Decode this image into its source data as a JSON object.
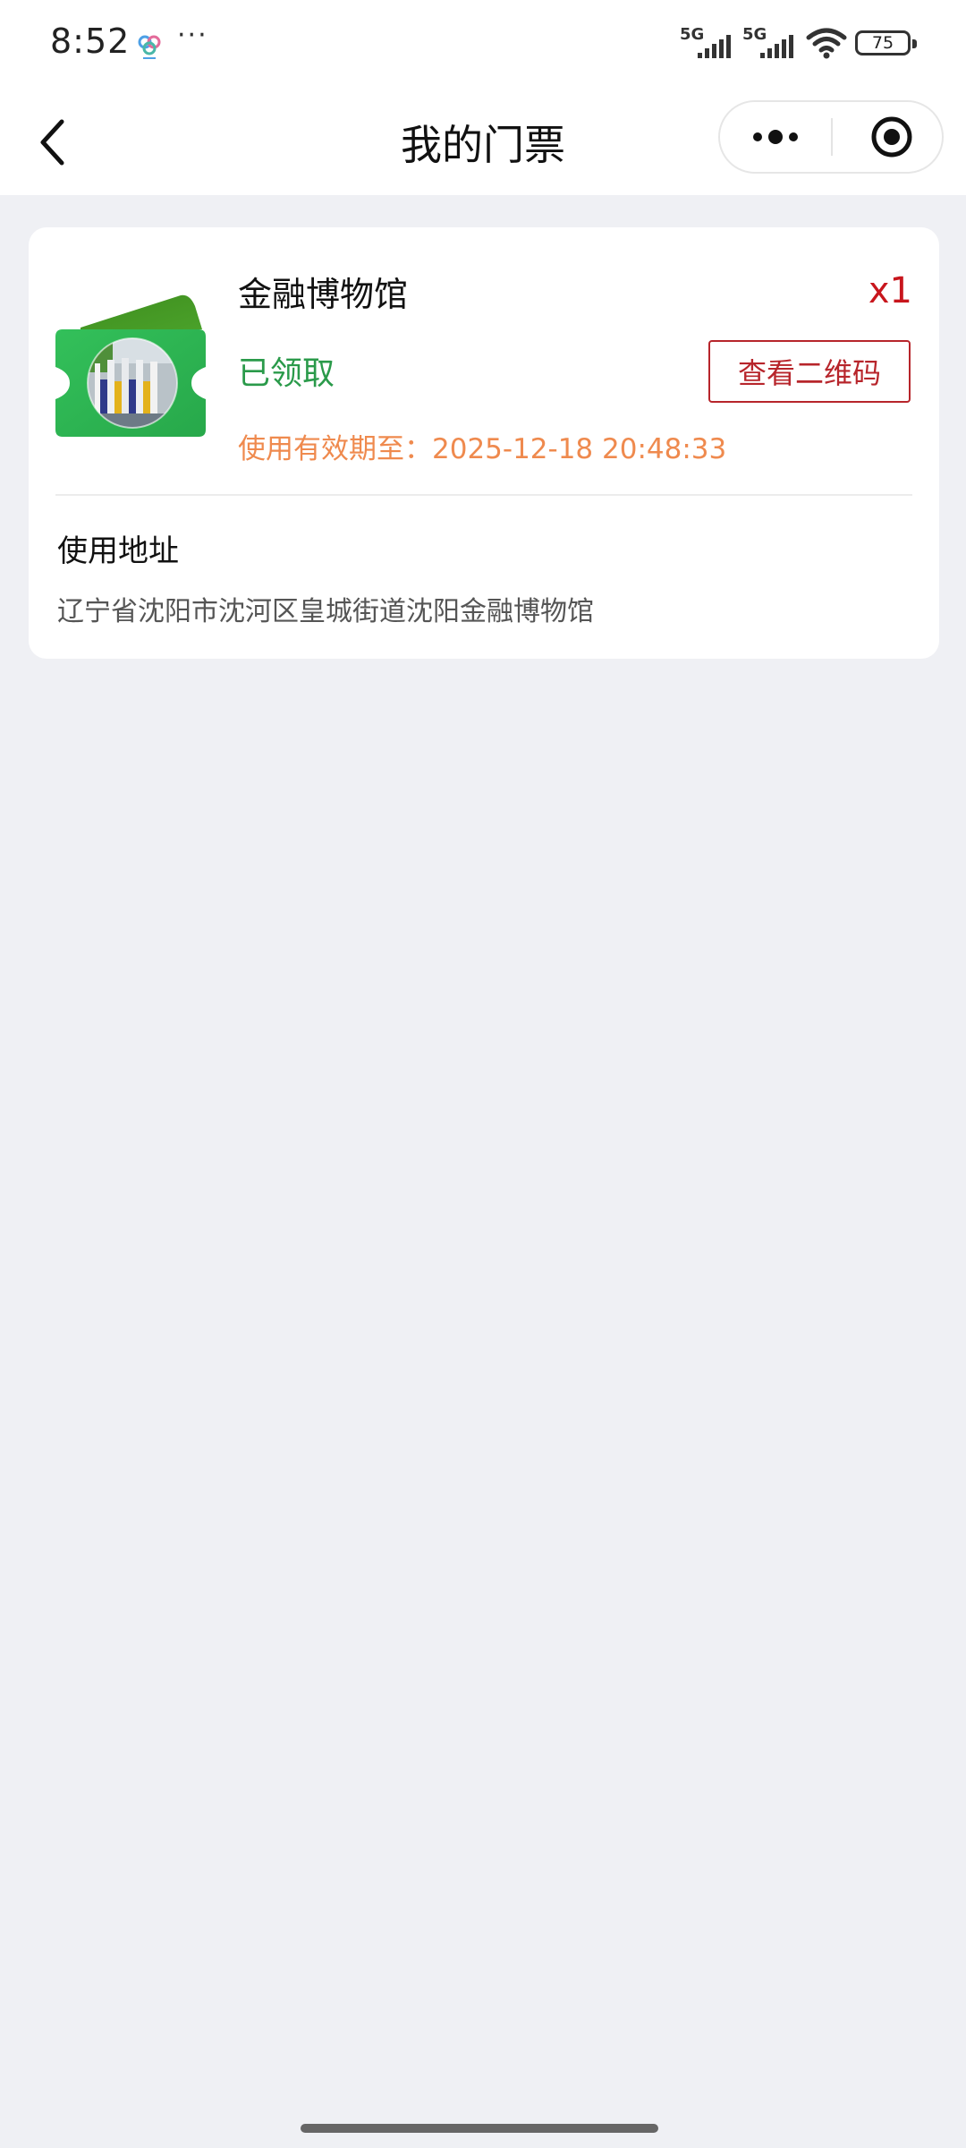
{
  "status_bar": {
    "time": "8:52",
    "more": "···",
    "app_icon": "cloud-app-icon",
    "signal_1_label": "5G",
    "signal_2_label": "5G",
    "battery": "75"
  },
  "nav": {
    "title": "我的门票",
    "back_icon": "back-arrow-icon",
    "more_icon": "more-dots-icon",
    "close_icon": "target-close-icon"
  },
  "ticket": {
    "name": "金融博物馆",
    "quantity": "x1",
    "status": "已领取",
    "qr_button_label": "查看二维码",
    "validity": "使用有效期至：2025-12-18 20:48:33",
    "address_label": "使用地址",
    "address": "辽宁省沈阳市沈河区皇城街道沈阳金融博物馆"
  },
  "colors": {
    "accent_red": "#c8161d",
    "status_green": "#2a9a4a",
    "validity_orange": "#ef8a4e",
    "background": "#eff0f4"
  }
}
